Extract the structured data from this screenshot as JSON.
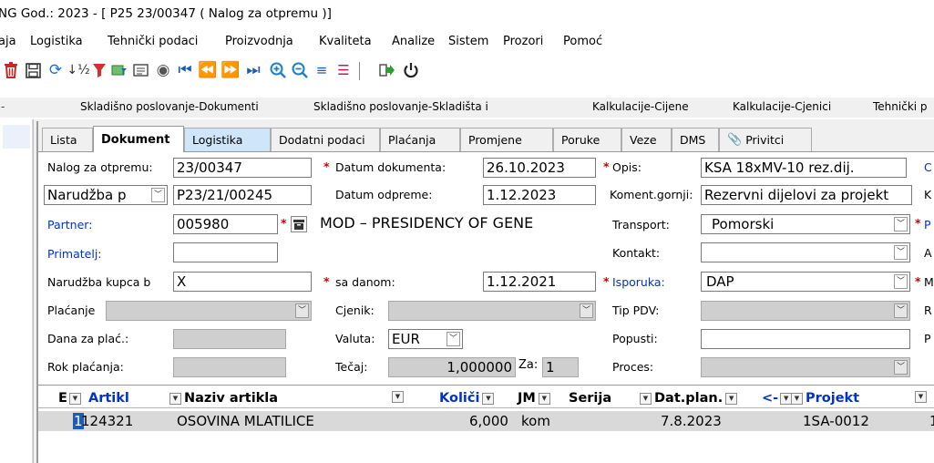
{
  "window": {
    "title": "NG God.: 2023 - [ P25 23/00347  ( Nalog za otpremu )]"
  },
  "menu": [
    "aja",
    "Logistika",
    "Tehnički podaci",
    "Proizvodnja",
    "Kvaliteta",
    "Analize",
    "Sistem",
    "Prozori",
    "Pomoć"
  ],
  "toolbar": {
    "icons": [
      "delete-icon",
      "save-icon",
      "refresh-icon",
      "sort-icon",
      "filter-icon",
      "filter-form-icon",
      "print-preview-icon",
      "view-icon",
      "first-record-icon",
      "previous-record-icon",
      "next-record-icon",
      "last-record-icon",
      "zoom-in-icon",
      "zoom-out-icon",
      "align-icon",
      "list-icon",
      "exit-icon",
      "power-icon"
    ]
  },
  "module_tabs": [
    "Skladišno poslovanje-Dokumenti",
    "Skladišno poslovanje-Skladišta i",
    "Kalkulacije-Cijene",
    "Kalkulacije-Cjenici",
    "Tehnički p"
  ],
  "tabs": [
    "Lista",
    "Dokument",
    "Logistika",
    "Dodatni podaci",
    "Plaćanja",
    "Promjene",
    "Poruke",
    "Veze",
    "DMS",
    "Privitci"
  ],
  "form": {
    "nalog_label": "Nalog za otpremu:",
    "nalog_value": "23/00347",
    "datum_dok_label": "Datum dokumenta:",
    "datum_dok_value": "26.10.2023",
    "opis_label": "Opis:",
    "opis_value": "KSA 18xMV-10 rez.dij.",
    "narudzba_type": "Narudžba p",
    "narudzba_value": "P23/21/00245",
    "datum_odp_label": "Datum odpreme:",
    "datum_odp_value": "1.12.2023",
    "koment_label": "Koment.gornji:",
    "koment_value": "Rezervni dijelovi za projekt",
    "partner_label": "Partner:",
    "partner_value": "005980",
    "partner_name": "MOD – PRESIDENCY OF GENE",
    "transport_label": "Transport:",
    "transport_value": "Pomorski",
    "primatelj_label": "Primatelj:",
    "kontakt_label": "Kontakt:",
    "narudzba_kupca_label": "Narudžba kupca b",
    "narudzba_kupca_value": "X",
    "sa_danom_label": "sa danom:",
    "sa_danom_value": "1.12.2021",
    "isporuka_label": "Isporuka:",
    "isporuka_value": "DAP",
    "placanje_label": "Plaćanje",
    "cjenik_label": "Cjenik:",
    "tip_pdv_label": "Tip PDV:",
    "dana_plac_label": "Dana za plać.:",
    "valuta_label": "Valuta:",
    "valuta_value": "EUR",
    "popusti_label": "Popusti:",
    "rok_plac_label": "Rok plaćanja:",
    "tecaj_label": "Tečaj:",
    "tecaj_value": "1,000000",
    "za_label": "Za:",
    "za_value": "1",
    "proces_label": "Proces:",
    "right_cut": [
      "C",
      "K",
      "P",
      "A",
      "M",
      "R",
      "P"
    ]
  },
  "grid": {
    "columns": [
      "E",
      "Artikl",
      "Naziv artikla",
      "Količi",
      "JM",
      "Serija",
      "Dat.plan.",
      "<-",
      "Projekt"
    ],
    "rows": [
      {
        "e": "1",
        "artikl": "124321",
        "naziv": "OSOVINA MLATILICE",
        "kolicina": "6,000",
        "jm": "kom",
        "serija": "",
        "dat_plan": "7.8.2023",
        "projekt": "1SA-0012",
        "last": "1"
      }
    ]
  }
}
